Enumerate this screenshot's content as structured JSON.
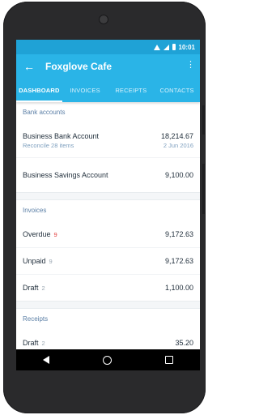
{
  "status_bar": {
    "time": "10:01"
  },
  "app_bar": {
    "title": "Foxglove Cafe",
    "back_icon": "arrow-left-icon",
    "menu_icon": "more-vert-icon"
  },
  "tabs": [
    {
      "label": "DASHBOARD",
      "active": true
    },
    {
      "label": "INVOICES",
      "active": false
    },
    {
      "label": "RECEIPTS",
      "active": false
    },
    {
      "label": "CONTACTS",
      "active": false
    }
  ],
  "bank_accounts": {
    "header": "Bank accounts",
    "items": [
      {
        "name": "Business Bank Account",
        "sub": "Reconcile 28 items",
        "amount": "18,214.67",
        "date": "2 Jun 2016"
      },
      {
        "name": "Business Savings Account",
        "amount": "9,100.00"
      }
    ]
  },
  "invoices": {
    "header": "Invoices",
    "items": [
      {
        "name": "Overdue",
        "count": "9",
        "amount": "9,172.63"
      },
      {
        "name": "Unpaid",
        "count": "9",
        "amount": "9,172.63"
      },
      {
        "name": "Draft",
        "count": "2",
        "amount": "1,100.00"
      }
    ]
  },
  "receipts": {
    "header": "Receipts",
    "items": [
      {
        "name": "Draft",
        "count": "2",
        "amount": "35.20"
      }
    ]
  },
  "colors": {
    "primary": "#2ab4e7",
    "status_bar": "#1fa2d6",
    "overdue": "#e23b3b"
  }
}
